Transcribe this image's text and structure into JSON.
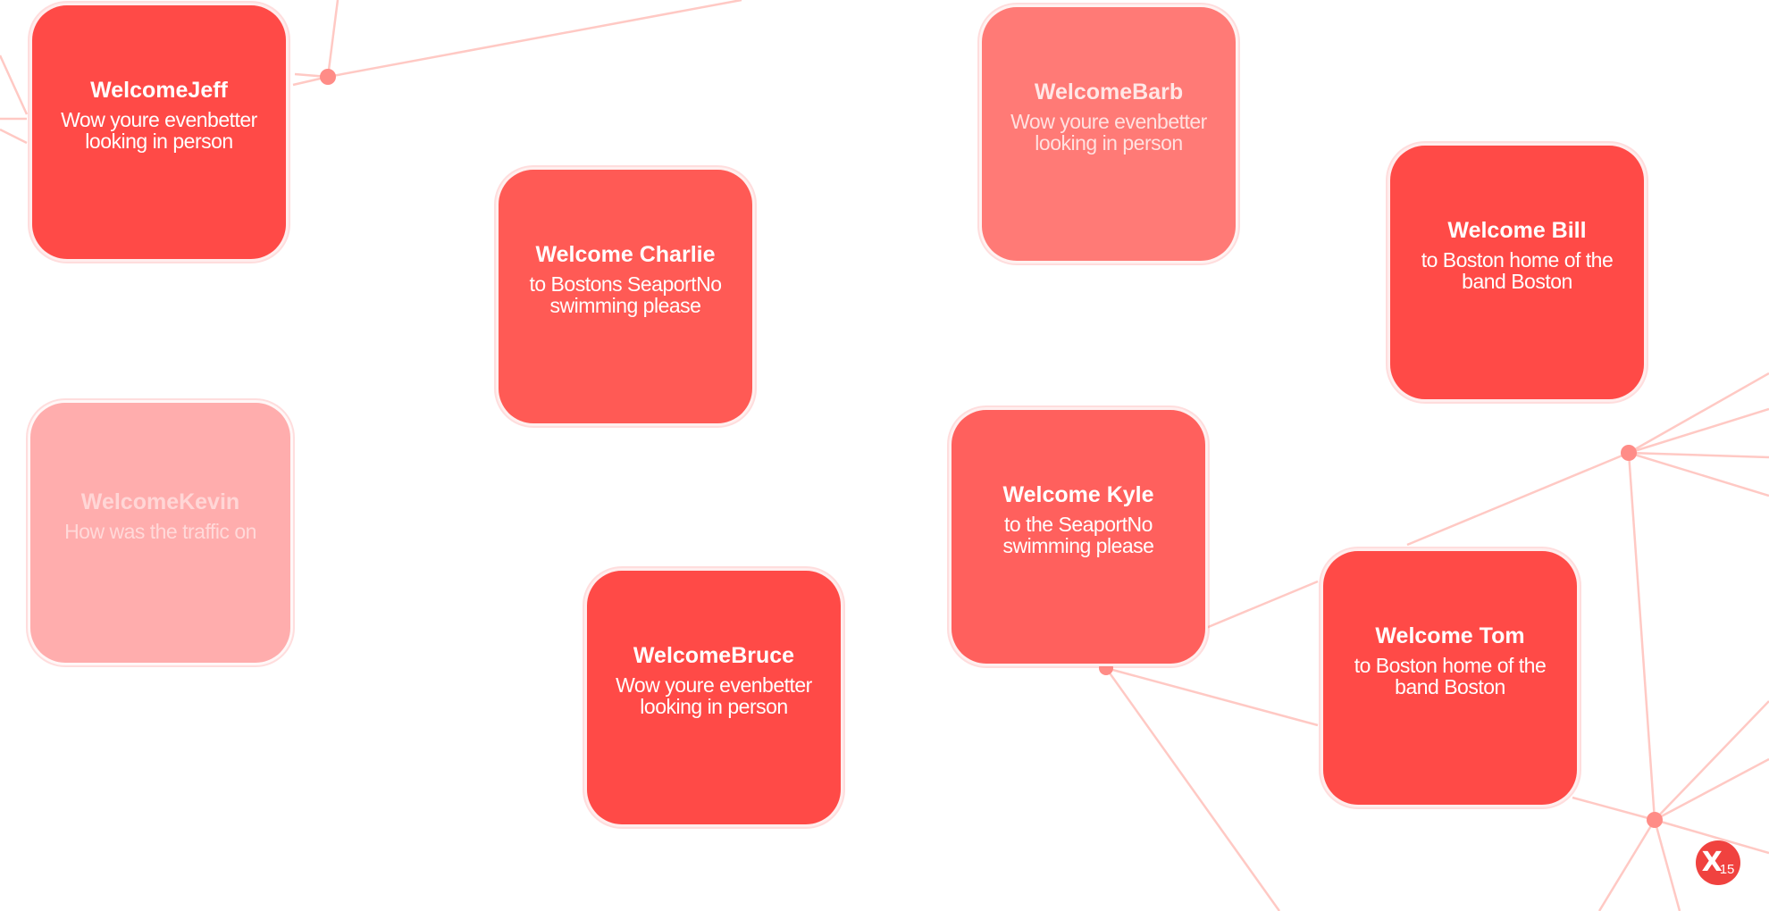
{
  "cards": [
    {
      "id": "jeff",
      "title": "WelcomeJeff",
      "message": "Wow youre evenbetter looking in person"
    },
    {
      "id": "charlie",
      "title": "Welcome Charlie",
      "message": "to Bostons SeaportNo swimming please"
    },
    {
      "id": "barb",
      "title": "WelcomeBarb",
      "message": "Wow youre evenbetter looking in person"
    },
    {
      "id": "bill",
      "title": "Welcome Bill",
      "message": "to Boston home of the band Boston"
    },
    {
      "id": "kevin",
      "title": "WelcomeKevin",
      "message": "How was the traffic on"
    },
    {
      "id": "kyle",
      "title": "Welcome Kyle",
      "message": "to the SeaportNo swimming please"
    },
    {
      "id": "bruce",
      "title": "WelcomeBruce",
      "message": "Wow youre evenbetter looking in person"
    },
    {
      "id": "tom",
      "title": "Welcome Tom",
      "message": "to Boston home of the band Boston"
    }
  ],
  "logo": {
    "mark": "X",
    "number": "15",
    "icon": "x15-logo-icon"
  },
  "colors": {
    "accent": "#ff4a47",
    "network_line": "#ffc2bd",
    "network_node": "#ff8a85"
  }
}
